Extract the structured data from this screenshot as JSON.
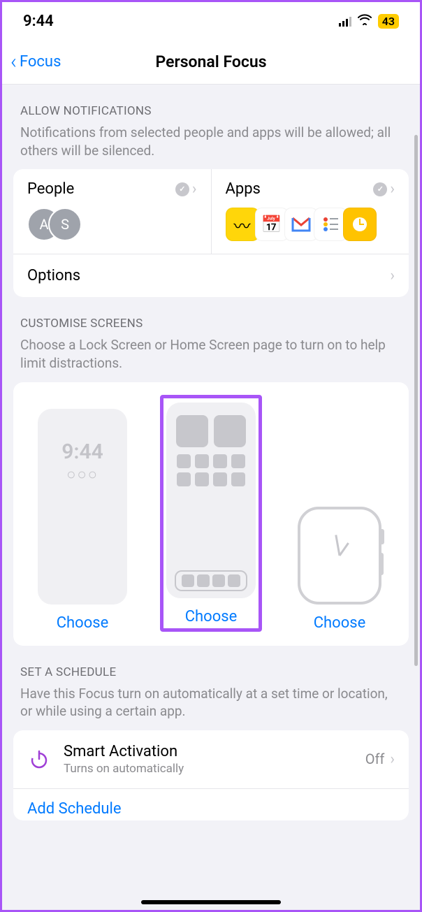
{
  "status": {
    "time": "9:44",
    "battery": "43"
  },
  "nav": {
    "back": "Focus",
    "title": "Personal Focus"
  },
  "allow": {
    "header": "ALLOW NOTIFICATIONS",
    "desc": "Notifications from selected people and apps will be allowed; all others will be silenced.",
    "people_label": "People",
    "apps_label": "Apps",
    "avatars": [
      "A",
      "S"
    ],
    "options": "Options"
  },
  "customise": {
    "header": "CUSTOMISE SCREENS",
    "desc": "Choose a Lock Screen or Home Screen page to turn on to help limit distractions.",
    "lock_time": "9:44",
    "choose": "Choose"
  },
  "schedule": {
    "header": "SET A SCHEDULE",
    "desc": "Have this Focus turn on automatically at a set time or location, or while using a certain app.",
    "smart_title": "Smart Activation",
    "smart_sub": "Turns on automatically",
    "smart_state": "Off",
    "add": "Add Schedule"
  }
}
